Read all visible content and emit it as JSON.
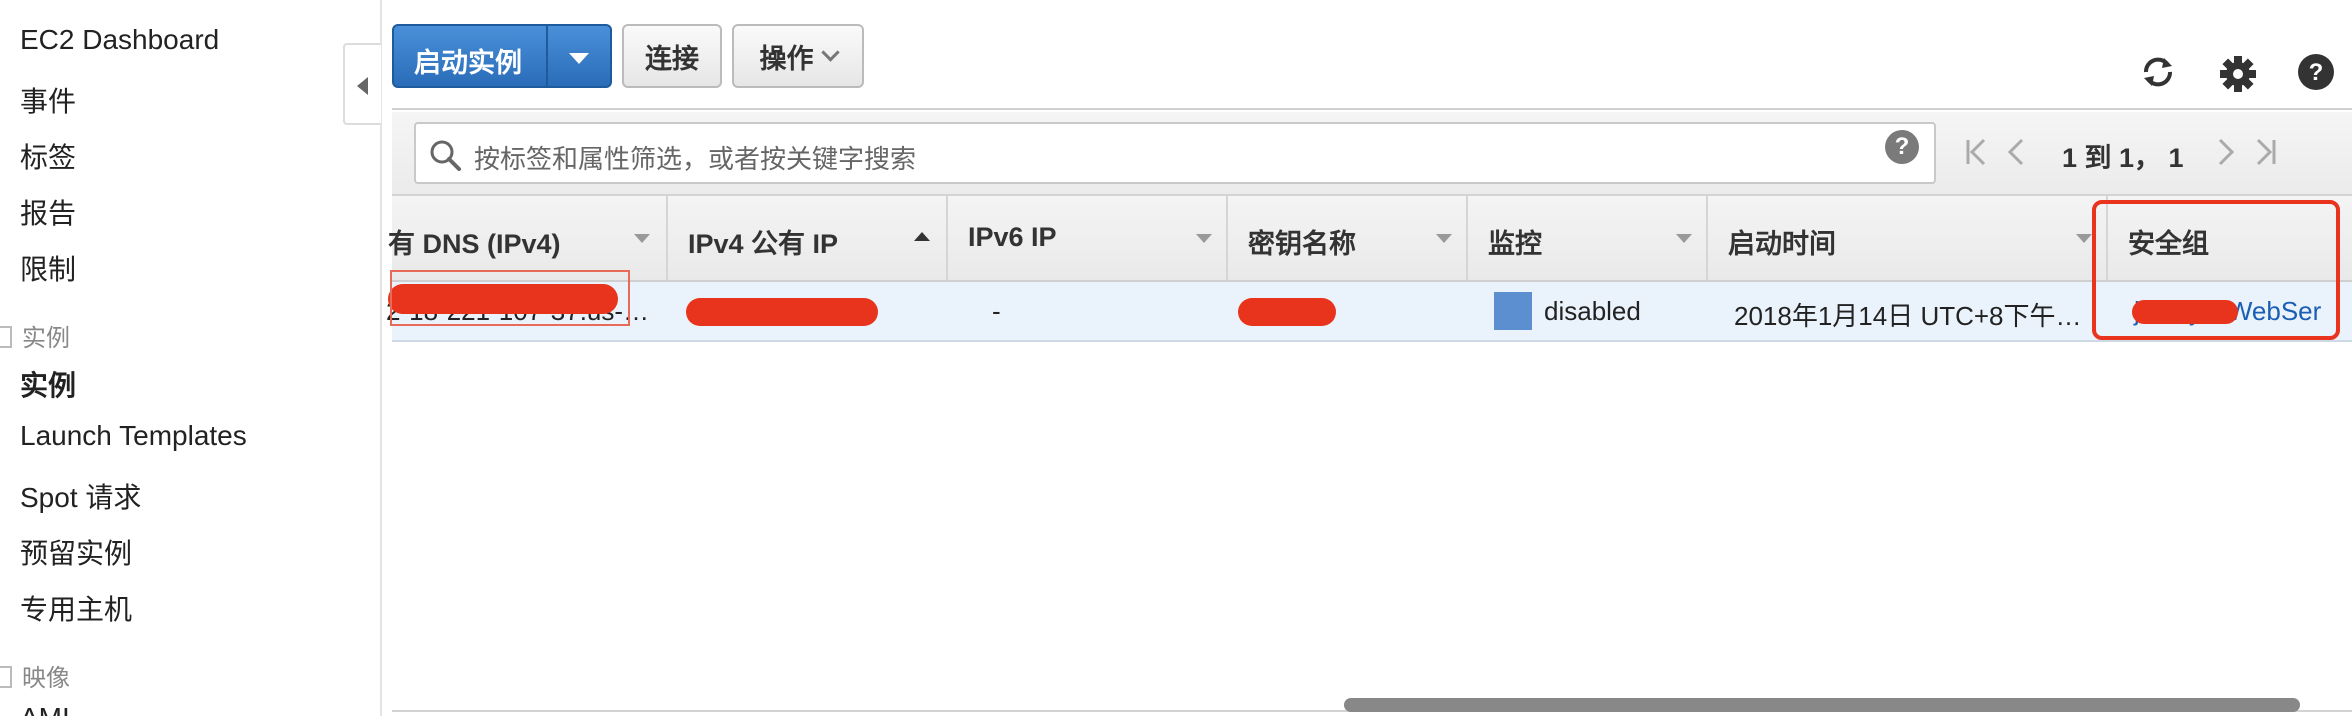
{
  "sidebar": {
    "items": [
      {
        "label": "EC2 Dashboard"
      },
      {
        "label": "事件"
      },
      {
        "label": "标签"
      },
      {
        "label": "报告"
      },
      {
        "label": "限制"
      }
    ],
    "section_instances": "实例",
    "instances_items": [
      {
        "label": "实例"
      },
      {
        "label": "Launch Templates"
      },
      {
        "label": "Spot 请求"
      },
      {
        "label": "预留实例"
      },
      {
        "label": "专用主机"
      }
    ],
    "section_images": "映像",
    "images_items": [
      {
        "label": "AMI"
      }
    ]
  },
  "toolbar": {
    "launch_label": "启动实例",
    "connect_label": "连接",
    "actions_label": "操作"
  },
  "filter": {
    "placeholder": "按标签和属性筛选，或者按关键字搜索",
    "help": "?",
    "pagination": "1 到 1， 1"
  },
  "table": {
    "columns": [
      "有 DNS (IPv4)",
      "IPv4 公有 IP",
      "IPv6 IP",
      "密钥名称",
      "监控",
      "启动时间",
      "安全组"
    ],
    "row": {
      "dns": "2-18-221-107-37.us-…",
      "ipv4": "",
      "ipv6": "-",
      "key_name": "",
      "monitoring": "disabled",
      "launch_time": "2018年1月14日 UTC+8下午…",
      "security_group": "jimmy-·-WebSer"
    }
  },
  "colors": {
    "primary": "#2a6cb8",
    "link": "#1a5fb4",
    "row_selected": "#eaf2fb",
    "annotation": "#e8341c",
    "monitor": "#5b8fcf"
  }
}
